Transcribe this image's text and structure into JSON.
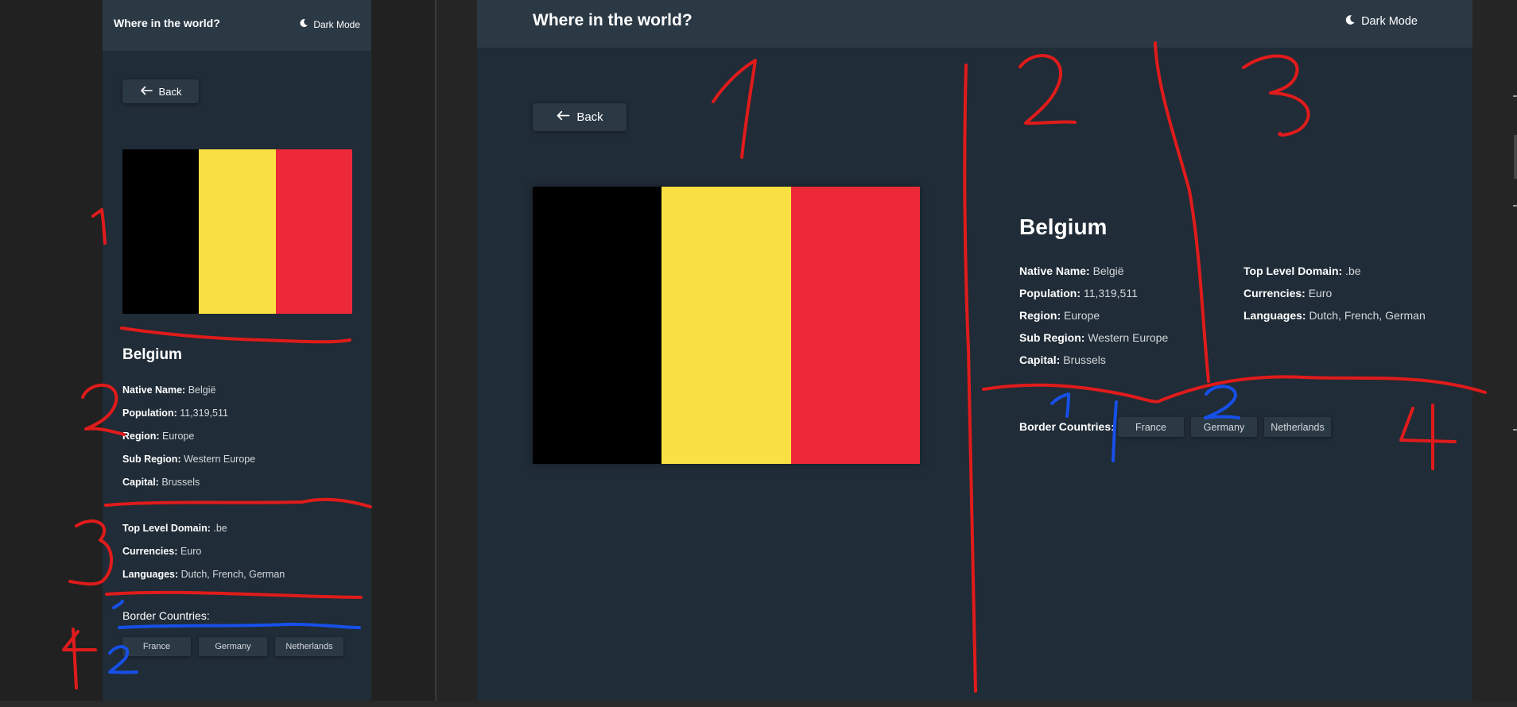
{
  "mobile": {
    "header": {
      "title": "Where in the world?",
      "dark_mode_label": "Dark Mode"
    },
    "back_label": "Back",
    "country": {
      "name": "Belgium",
      "primary_info": [
        {
          "label": "Native Name:",
          "value": "België"
        },
        {
          "label": "Population:",
          "value": "11,319,511"
        },
        {
          "label": "Region:",
          "value": "Europe"
        },
        {
          "label": "Sub Region:",
          "value": "Western Europe"
        },
        {
          "label": "Capital:",
          "value": "Brussels"
        }
      ],
      "secondary_info": [
        {
          "label": "Top Level Domain:",
          "value": ".be"
        },
        {
          "label": "Currencies:",
          "value": "Euro"
        },
        {
          "label": "Languages:",
          "value": "Dutch, French, German"
        }
      ],
      "border_label": "Border Countries:",
      "borders": [
        "France",
        "Germany",
        "Netherlands"
      ]
    }
  },
  "desktop": {
    "header": {
      "title": "Where in the world?",
      "dark_mode_label": "Dark Mode"
    },
    "back_label": "Back",
    "country": {
      "name": "Belgium",
      "primary_info": [
        {
          "label": "Native Name:",
          "value": "België"
        },
        {
          "label": "Population:",
          "value": "11,319,511"
        },
        {
          "label": "Region:",
          "value": "Europe"
        },
        {
          "label": "Sub Region:",
          "value": "Western Europe"
        },
        {
          "label": "Capital:",
          "value": "Brussels"
        }
      ],
      "secondary_info": [
        {
          "label": "Top Level Domain:",
          "value": ".be"
        },
        {
          "label": "Currencies:",
          "value": "Euro"
        },
        {
          "label": "Languages:",
          "value": "Dutch, French, German"
        }
      ],
      "border_label": "Border Countries:",
      "borders": [
        "France",
        "Germany",
        "Netherlands"
      ]
    }
  },
  "flag_colors": [
    "#000000",
    "#fae042",
    "#ed2939"
  ],
  "annotations": {
    "ink_colors": {
      "red": "#e01b1b",
      "blue": "#1650e8"
    },
    "left_numbers": [
      "1",
      "2",
      "3",
      "4",
      "1",
      "2"
    ],
    "right_numbers": [
      "1",
      "2",
      "3",
      "4",
      "1",
      "2"
    ]
  }
}
